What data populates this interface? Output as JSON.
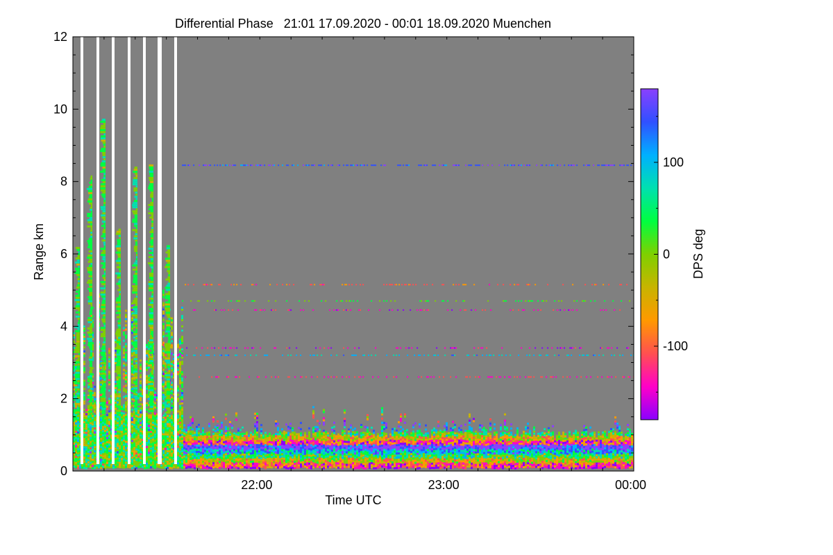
{
  "chart_data": {
    "type": "heatmap",
    "title": "Differential Phase   21:01 17.09.2020 - 00:01 18.09.2020 Muenchen",
    "xlabel": "Time UTC",
    "ylabel": "Range km",
    "x_range": [
      "21:01",
      "00:01"
    ],
    "ylim": [
      0,
      12
    ],
    "x_ticks": [
      "22:00",
      "23:00",
      "00:00"
    ],
    "y_ticks": [
      0,
      2,
      4,
      6,
      8,
      10,
      12
    ],
    "colorbar": {
      "label": "DPS deg",
      "range": [
        -180,
        180
      ],
      "ticks": [
        100,
        0,
        -100
      ],
      "colors": [
        "#8a00ff",
        "#ff00c8",
        "#ff5050",
        "#ff9900",
        "#c8b400",
        "#7fd000",
        "#00ff40",
        "#00e0b0",
        "#00b0ff",
        "#3050ff",
        "#8a40ff"
      ]
    },
    "no_data_color": "#808080",
    "features": [
      {
        "type": "noise_layer",
        "range_km": [
          0,
          1.6
        ],
        "time": [
          "21:01",
          "00:01"
        ]
      },
      {
        "type": "band",
        "range_km": 8.45,
        "time": [
          "21:36",
          "00:01"
        ],
        "value_deg": 150
      },
      {
        "type": "band",
        "range_km": 5.15,
        "time": [
          "21:36",
          "00:01"
        ],
        "value_deg": -100
      },
      {
        "type": "band",
        "range_km": 4.7,
        "time": [
          "21:36",
          "00:01"
        ],
        "value_deg": 20
      },
      {
        "type": "band",
        "range_km": 4.45,
        "time": [
          "21:36",
          "00:01"
        ],
        "value_deg": -140
      },
      {
        "type": "band",
        "range_km": 3.4,
        "time": [
          "21:36",
          "00:01"
        ],
        "value_deg": -150
      },
      {
        "type": "band",
        "range_km": 3.2,
        "time": [
          "21:36",
          "00:01"
        ],
        "value_deg": 100
      },
      {
        "type": "band",
        "range_km": 2.6,
        "time": [
          "21:36",
          "00:01"
        ],
        "value_deg": -130
      }
    ]
  }
}
